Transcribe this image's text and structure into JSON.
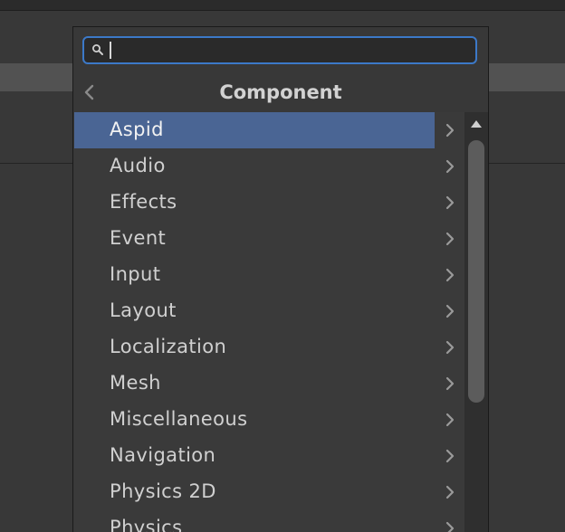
{
  "search": {
    "value": "",
    "placeholder": ""
  },
  "header": {
    "title": "Component"
  },
  "items": [
    {
      "label": "Aspid",
      "selected": true
    },
    {
      "label": "Audio"
    },
    {
      "label": "Effects"
    },
    {
      "label": "Event"
    },
    {
      "label": "Input"
    },
    {
      "label": "Layout"
    },
    {
      "label": "Localization"
    },
    {
      "label": "Mesh"
    },
    {
      "label": "Miscellaneous"
    },
    {
      "label": "Navigation"
    },
    {
      "label": "Physics 2D"
    },
    {
      "label": "Physics"
    }
  ],
  "icons": {
    "search": "search-icon",
    "back": "chevron-left-icon",
    "item_arrow": "chevron-right-icon",
    "scroll_up": "arrow-up-icon"
  },
  "colors": {
    "accent": "#3c79c8",
    "selection": "#4a6594",
    "panel": "#383838"
  }
}
